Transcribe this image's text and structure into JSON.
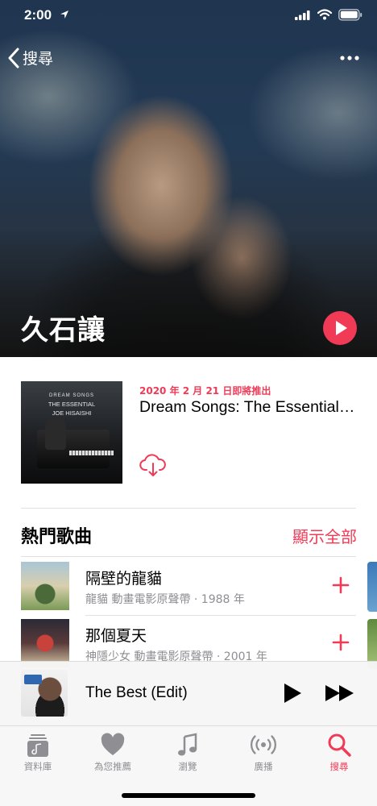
{
  "status_bar": {
    "time": "2:00"
  },
  "nav": {
    "back_label": "搜尋"
  },
  "artist": {
    "name": "久石讓"
  },
  "latest_release": {
    "date": "2020 年 2 月 21 日即將推出",
    "title": "Dream Songs: The Essential Joe Hisaishi",
    "cover_text": [
      "DREAM SONGS",
      "THE ESSENTIAL",
      "JOE HISAISHI"
    ]
  },
  "top_songs": {
    "title": "熱門歌曲",
    "show_all": "顯示全部",
    "items": [
      {
        "title": "隔壁的龍貓",
        "subtitle": "龍貓 動畫電影原聲帶 · 1988 年"
      },
      {
        "title": "那個夏天",
        "subtitle": "神隱少女 動畫電影原聲帶 · 2001 年"
      }
    ]
  },
  "mini_player": {
    "title": "The Best (Edit)"
  },
  "tab_bar": {
    "items": [
      {
        "label": "資料庫",
        "icon": "library-icon"
      },
      {
        "label": "為您推薦",
        "icon": "heart-icon"
      },
      {
        "label": "瀏覽",
        "icon": "music-note-icon"
      },
      {
        "label": "廣播",
        "icon": "radio-icon"
      },
      {
        "label": "搜尋",
        "icon": "search-icon"
      }
    ],
    "active_index": 4
  },
  "colors": {
    "accent": "#f03a56",
    "secondary_text": "#8e8e93"
  }
}
